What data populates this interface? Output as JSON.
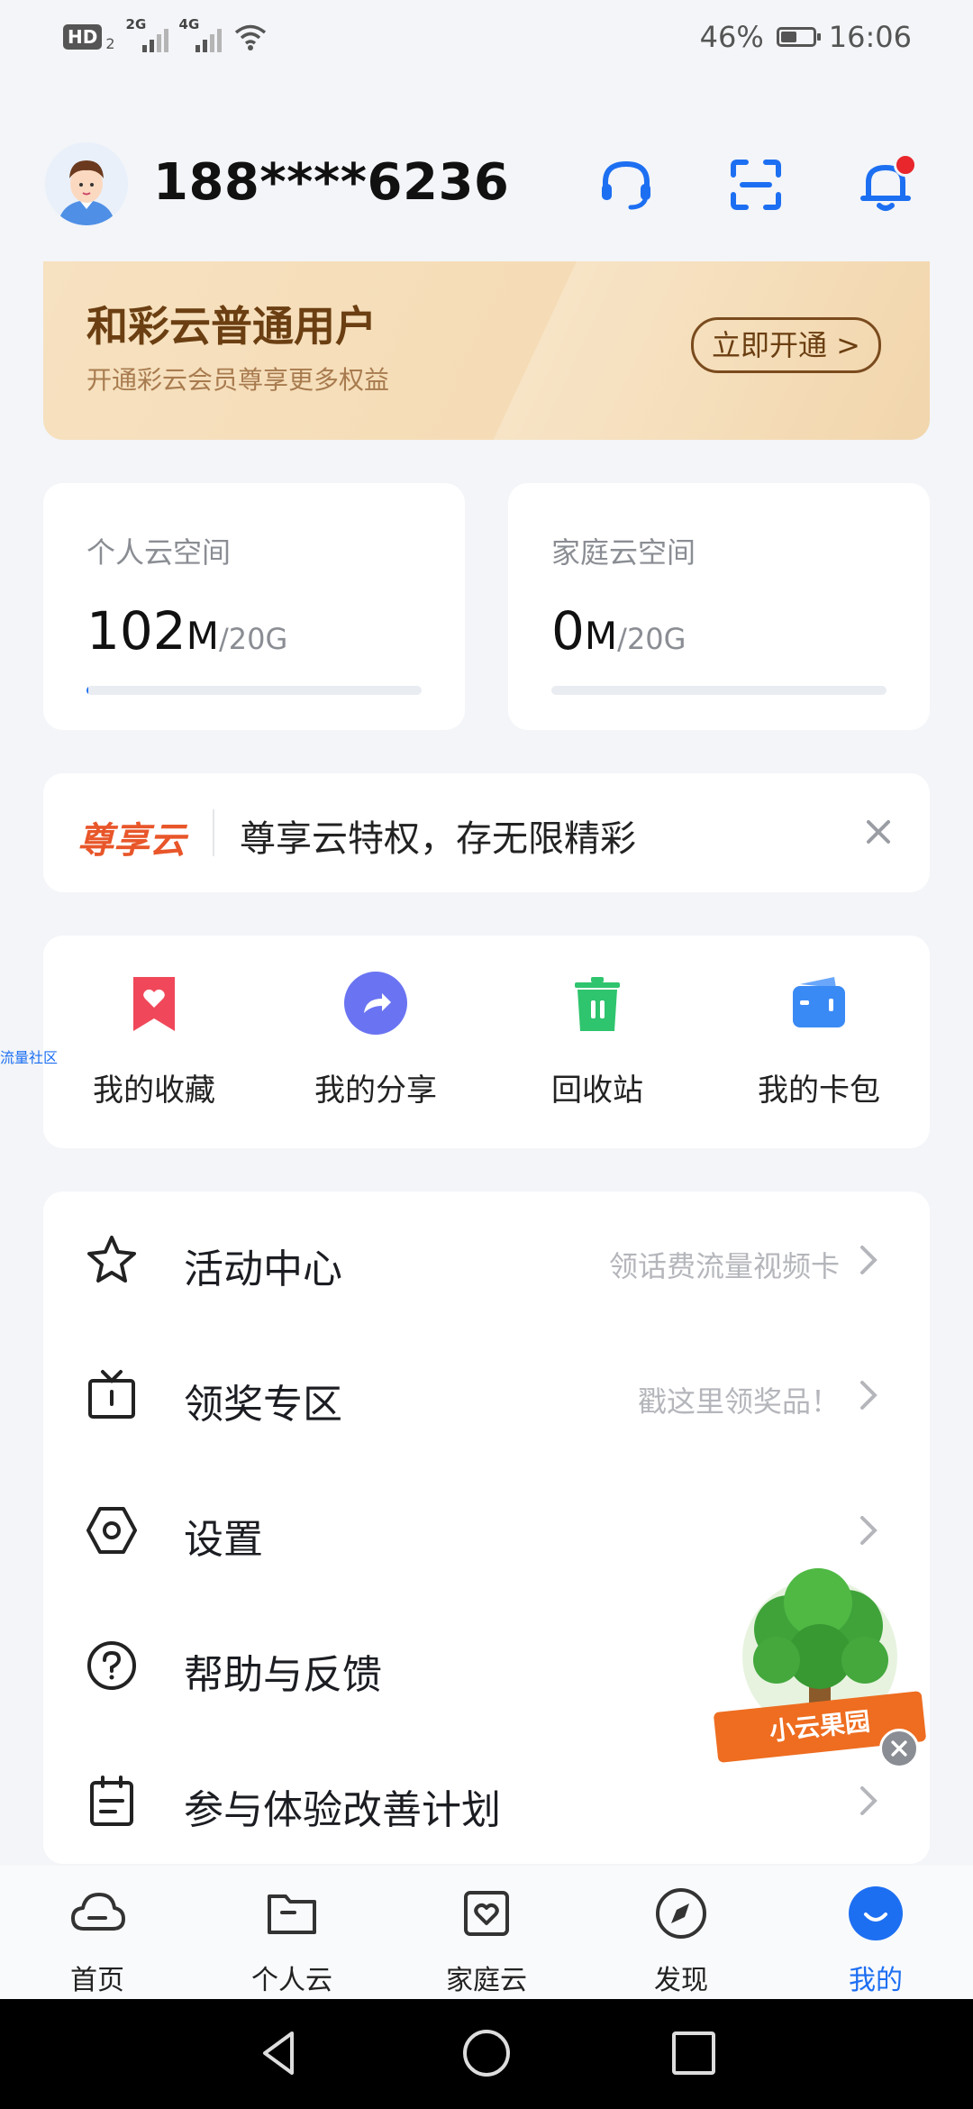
{
  "status_bar": {
    "hd": "HD",
    "hd_sub": "2",
    "sim1": "2G",
    "sim2": "4G",
    "battery": "46%",
    "battery_level": 0.46,
    "time": "16:06"
  },
  "header": {
    "username": "188****6236",
    "icons": [
      "headset-icon",
      "scan-icon",
      "bell-icon"
    ],
    "has_notification": true
  },
  "vip_banner": {
    "title": "和彩云普通用户",
    "subtitle": "开通彩云会员尊享更多权益",
    "button": "立即开通 >"
  },
  "storage": {
    "personal": {
      "label": "个人云空间",
      "value": "102",
      "unit": "M",
      "total": "/20G",
      "fraction": 0.005
    },
    "family": {
      "label": "家庭云空间",
      "value": "0",
      "unit": "M",
      "total": "/20G",
      "fraction": 0.0
    }
  },
  "promo": {
    "logo": "尊享云",
    "text": "尊享云特权，存无限精彩"
  },
  "quick_actions": [
    {
      "label": "我的收藏",
      "icon": "bookmark-heart-icon",
      "color": "#f0485a"
    },
    {
      "label": "我的分享",
      "icon": "share-icon",
      "color": "#6a74f2"
    },
    {
      "label": "回收站",
      "icon": "trash-icon",
      "color": "#2fc46e"
    },
    {
      "label": "我的卡包",
      "icon": "wallet-icon",
      "color": "#3a8af5"
    }
  ],
  "side_link": "流量社区",
  "menu": [
    {
      "label": "活动中心",
      "hint": "领话费流量视频卡",
      "icon": "star-icon"
    },
    {
      "label": "领奖专区",
      "hint": "戳这里领奖品！",
      "icon": "tv-icon"
    },
    {
      "label": "设置",
      "hint": "",
      "icon": "settings-icon"
    },
    {
      "label": "帮助与反馈",
      "hint": "",
      "icon": "help-icon"
    },
    {
      "label": "参与体验改善计划",
      "hint": "",
      "icon": "clipboard-icon"
    }
  ],
  "floating_widget": {
    "label": "小云果园"
  },
  "tabs": [
    {
      "label": "首页",
      "icon": "cloud-icon"
    },
    {
      "label": "个人云",
      "icon": "folder-icon"
    },
    {
      "label": "家庭云",
      "icon": "family-heart-icon"
    },
    {
      "label": "发现",
      "icon": "compass-icon"
    },
    {
      "label": "我的",
      "icon": "profile-smile-icon",
      "active": true
    }
  ],
  "colors": {
    "accent": "#1d6ff2",
    "notification": "#e8262b",
    "vip_text": "#6b3f12",
    "promo_logo": "#e8562a"
  }
}
